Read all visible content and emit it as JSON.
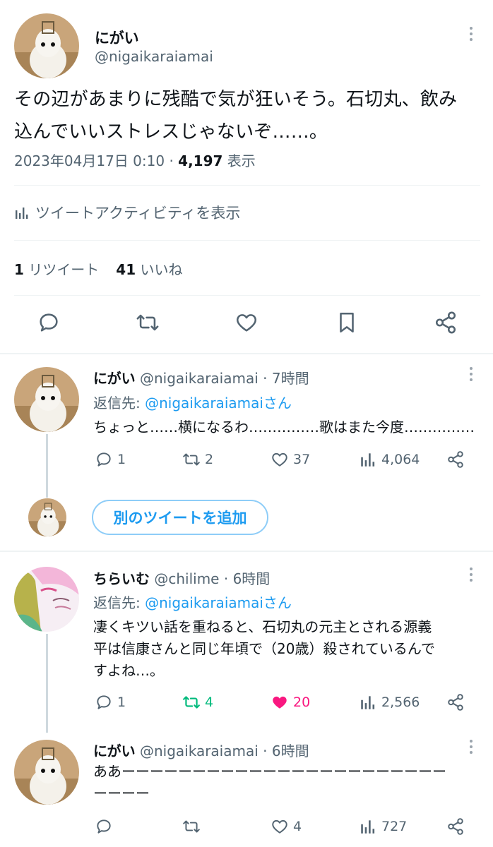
{
  "main_tweet": {
    "display_name": "にがい",
    "handle": "@nigaikaraiamai",
    "text_line1": "その辺があまりに残酷で気が狂いそう。石切丸、飲み",
    "text_line2": "込んでいいストレスじゃないぞ……。",
    "timestamp": "2023年04月17日 0:10",
    "separator": "·",
    "views_count": "4,197",
    "views_label": "表示",
    "activity_label": "ツイートアクティビティを表示",
    "retweets_count": "1",
    "retweets_label": "リツイート",
    "likes_count": "41",
    "likes_label": "いいね"
  },
  "replies": [
    {
      "display_name": "にがい",
      "handle": "@nigaikaraiamai",
      "time": "· 7時間",
      "reply_to_prefix": "返信先: ",
      "reply_to_handle": "@nigaikaraiamaiさん",
      "text_lines": [
        "ちょっと……横になるわ……………歌はまた今度……………"
      ],
      "replies_count": "1",
      "retweets_count": "2",
      "likes_count": "37",
      "views_count": "4,064"
    },
    {
      "display_name": "ちらいむ",
      "handle": "@chilime",
      "time": "· 6時間",
      "reply_to_prefix": "返信先: ",
      "reply_to_handle": "@nigaikaraiamaiさん",
      "text_lines": [
        "凄くキツい話を重ねると、石切丸の元主とされる源義",
        "平は信康さんと同じ年頃で（20歳）殺されているんで",
        "すよね…。"
      ],
      "replies_count": "1",
      "retweets_count": "4",
      "likes_count": "20",
      "views_count": "2,566"
    },
    {
      "display_name": "にがい",
      "handle": "@nigaikaraiamai",
      "time": "· 6時間",
      "text_lines": [
        "ああーーーーーーーーーーーーーーーーーーーーーーー",
        "ーーーー"
      ],
      "likes_count": "4",
      "views_count": "727"
    }
  ],
  "add_tweet_button": "別のツイートを追加",
  "colors": {
    "text": "#0f1419",
    "secondary": "#536471",
    "link": "#1d9bf0",
    "retweet_active": "#00ba7c",
    "like_active": "#f91880",
    "divider": "#eff3f4"
  },
  "icons": [
    "more-icon",
    "chart-icon",
    "reply-icon",
    "retweet-icon",
    "like-icon",
    "bookmark-icon",
    "share-icon",
    "views-icon"
  ]
}
